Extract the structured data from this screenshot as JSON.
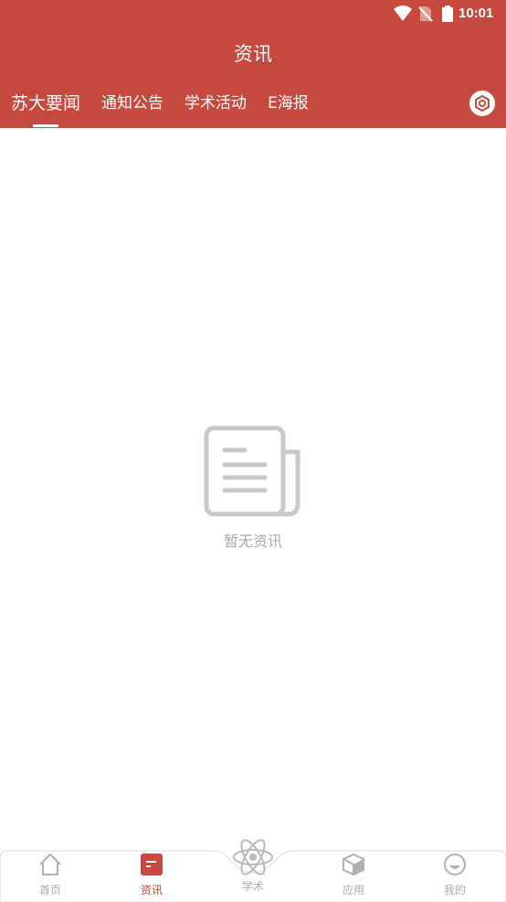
{
  "status_bar": {
    "time": "10:01"
  },
  "header": {
    "title": "资讯"
  },
  "tabs": [
    {
      "label": "苏大要闻",
      "active": true
    },
    {
      "label": "通知公告",
      "active": false
    },
    {
      "label": "学术活动",
      "active": false
    },
    {
      "label": "E海报",
      "active": false
    }
  ],
  "empty_state": {
    "message": "暂无资讯"
  },
  "bottom_nav": [
    {
      "label": "首页",
      "icon": "home-icon",
      "active": false
    },
    {
      "label": "资讯",
      "icon": "news-icon",
      "active": true
    },
    {
      "label": "学术",
      "icon": "atom-icon",
      "active": false
    },
    {
      "label": "应用",
      "icon": "cube-icon",
      "active": false
    },
    {
      "label": "我的",
      "icon": "smile-icon",
      "active": false
    }
  ],
  "colors": {
    "primary": "#c5493d",
    "inactive": "#aaaaaa",
    "empty_icon": "#c8c8c8",
    "empty_text": "#a8a8a8"
  }
}
